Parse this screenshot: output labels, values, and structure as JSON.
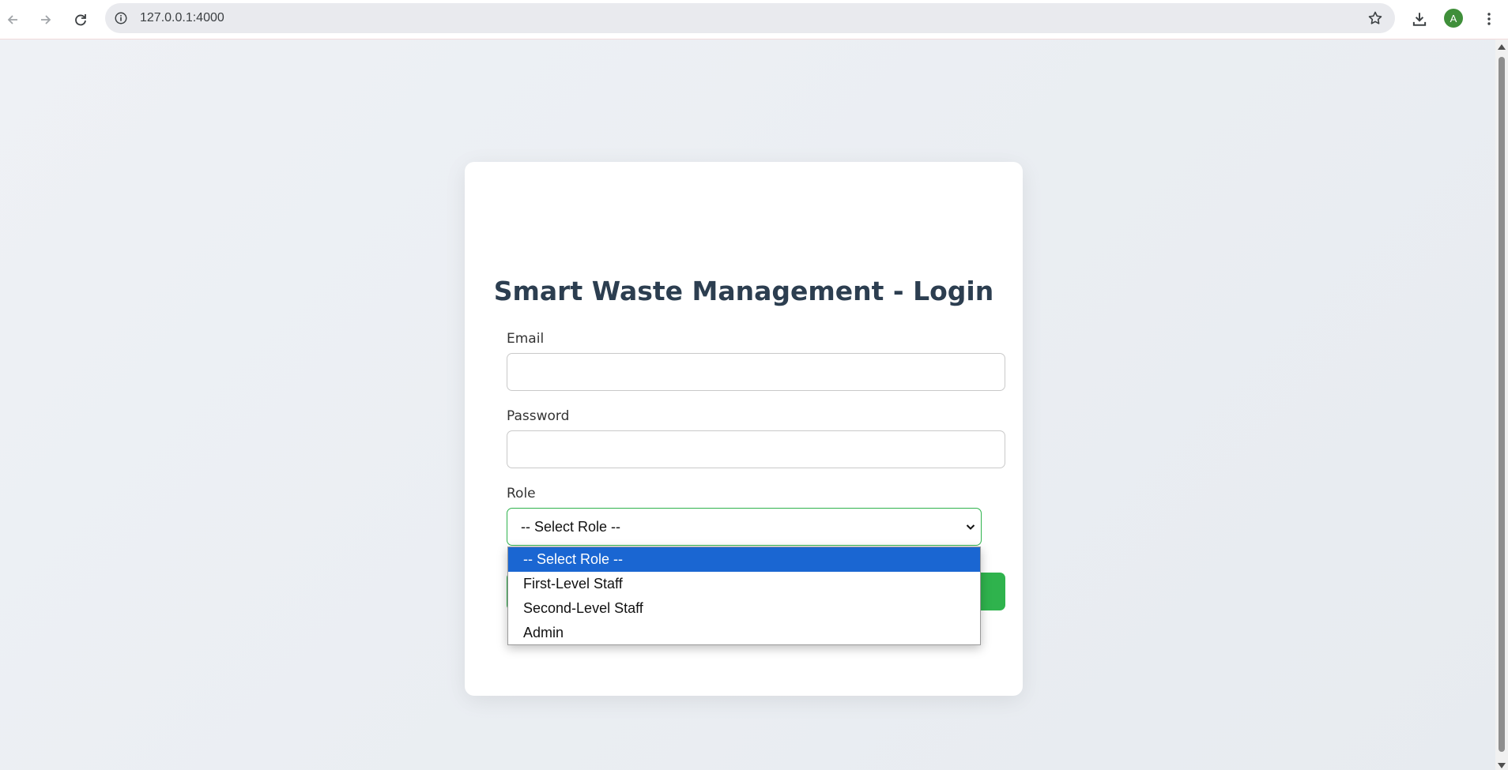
{
  "browser": {
    "url": "127.0.0.1:4000",
    "profile_initial": "A",
    "icons": {
      "back": "arrow-left-icon",
      "forward": "arrow-right-icon",
      "reload": "reload-icon",
      "site_info": "info-icon",
      "bookmark": "star-icon",
      "downloads": "download-icon",
      "menu": "kebab-menu-icon"
    }
  },
  "login": {
    "title": "Smart Waste Management - Login",
    "email_label": "Email",
    "email_value": "",
    "password_label": "Password",
    "password_value": "",
    "role_label": "Role",
    "role_selected": "-- Select Role --",
    "role_options": [
      "-- Select Role --",
      "First-Level Staff",
      "Second-Level Staff",
      "Admin"
    ]
  },
  "colors": {
    "accent_green": "#2fb34d",
    "title_color": "#2c3e50",
    "option_highlight": "#1a66d2"
  }
}
